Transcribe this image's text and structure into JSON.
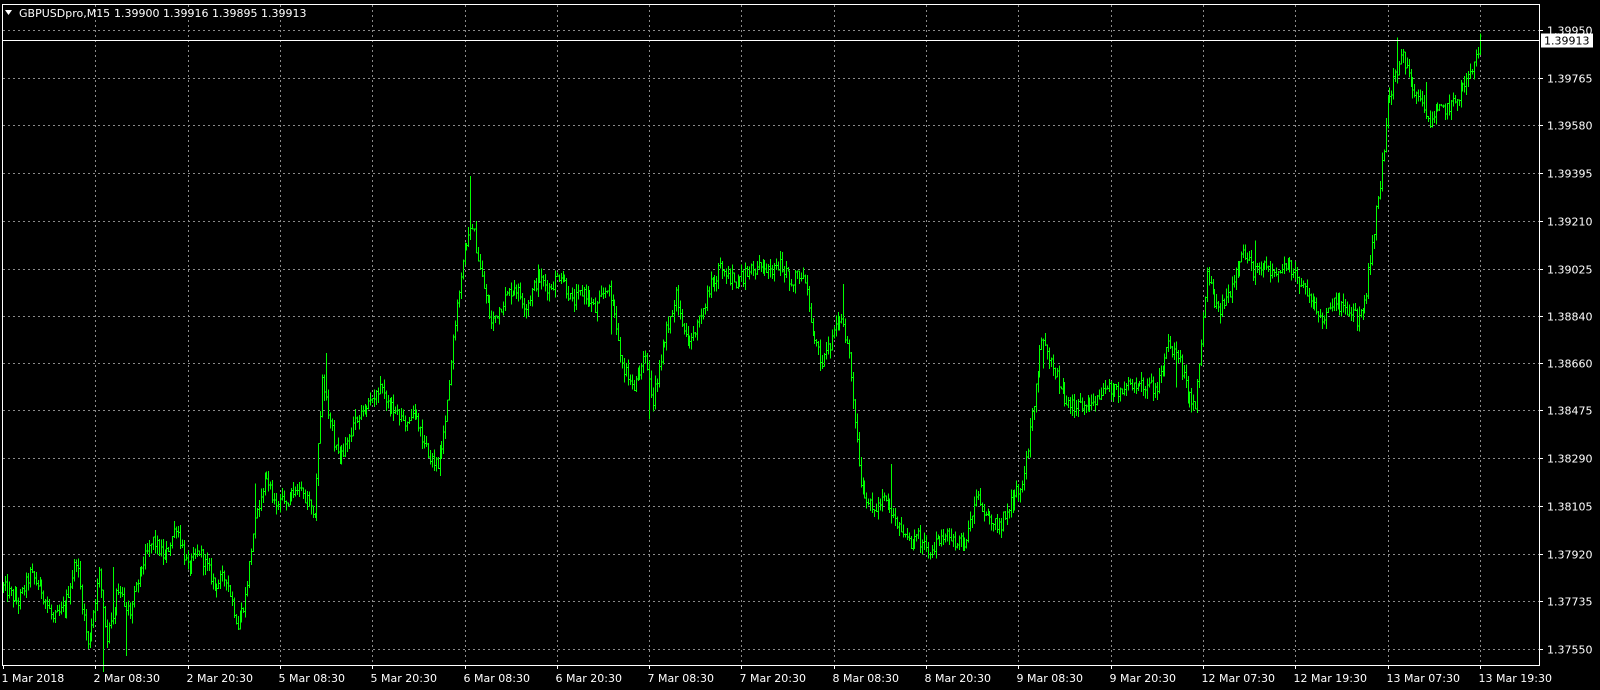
{
  "header": {
    "symbol": "GBPUSDpro,M15",
    "ohlc": "1.39900 1.39916 1.39895 1.39913"
  },
  "colors": {
    "background": "#000000",
    "grid": "#8a8a8a",
    "bars": "#00ff00",
    "frame": "#ffffff",
    "text": "#ffffff",
    "price_line": "#ffffff"
  },
  "chart_data": {
    "type": "line",
    "style": "ohlc-bars",
    "title": "",
    "xlabel": "",
    "ylabel": "",
    "grid": true,
    "ylim": [
      1.3746,
      1.4002
    ],
    "current_price": 1.39913,
    "current_price_label": "1.39913",
    "y_ticks": [
      {
        "value": 1.3995,
        "label": "1.39950"
      },
      {
        "value": 1.39765,
        "label": "1.39765"
      },
      {
        "value": 1.3958,
        "label": "1.39580"
      },
      {
        "value": 1.39395,
        "label": "1.39395"
      },
      {
        "value": 1.3921,
        "label": "1.39210"
      },
      {
        "value": 1.39025,
        "label": "1.39025"
      },
      {
        "value": 1.3884,
        "label": "1.38840"
      },
      {
        "value": 1.3866,
        "label": "1.38660"
      },
      {
        "value": 1.38475,
        "label": "1.38475"
      },
      {
        "value": 1.3829,
        "label": "1.38290"
      },
      {
        "value": 1.38105,
        "label": "1.38105"
      },
      {
        "value": 1.3792,
        "label": "1.37920"
      },
      {
        "value": 1.37735,
        "label": "1.37735"
      },
      {
        "value": 1.3755,
        "label": "1.37550"
      }
    ],
    "x_ticks": [
      "1 Mar 2018",
      "2 Mar 08:30",
      "2 Mar 20:30",
      "5 Mar 08:30",
      "5 Mar 20:30",
      "6 Mar 08:30",
      "6 Mar 20:30",
      "7 Mar 08:30",
      "7 Mar 20:30",
      "8 Mar 08:30",
      "8 Mar 20:30",
      "9 Mar 08:30",
      "9 Mar 20:30",
      "12 Mar 07:30",
      "12 Mar 19:30",
      "13 Mar 07:30",
      "13 Mar 19:30"
    ],
    "series": [
      {
        "bars_per_x_tick": 48,
        "close_path": [
          [
            0,
            1.3779
          ],
          [
            8,
            1.3773
          ],
          [
            14,
            1.3784
          ],
          [
            20,
            1.3778
          ],
          [
            26,
            1.3766
          ],
          [
            32,
            1.3771
          ],
          [
            38,
            1.379
          ],
          [
            44,
            1.3756
          ],
          [
            50,
            1.3784
          ],
          [
            54,
            1.376
          ],
          [
            60,
            1.3778
          ],
          [
            66,
            1.3769
          ],
          [
            72,
            1.3787
          ],
          [
            78,
            1.3797
          ],
          [
            84,
            1.379
          ],
          [
            90,
            1.3803
          ],
          [
            96,
            1.3786
          ],
          [
            102,
            1.3793
          ],
          [
            110,
            1.378
          ],
          [
            116,
            1.3783
          ],
          [
            122,
            1.3764
          ],
          [
            126,
            1.3775
          ],
          [
            130,
            1.38
          ],
          [
            136,
            1.3822
          ],
          [
            142,
            1.3811
          ],
          [
            148,
            1.3812
          ],
          [
            152,
            1.3818
          ],
          [
            158,
            1.3812
          ],
          [
            162,
            1.3808
          ],
          [
            166,
            1.3861
          ],
          [
            172,
            1.3835
          ],
          [
            176,
            1.383
          ],
          [
            180,
            1.3837
          ],
          [
            186,
            1.3848
          ],
          [
            192,
            1.3851
          ],
          [
            196,
            1.3855
          ],
          [
            202,
            1.3848
          ],
          [
            208,
            1.3842
          ],
          [
            214,
            1.3846
          ],
          [
            220,
            1.3832
          ],
          [
            226,
            1.3825
          ],
          [
            230,
            1.3841
          ],
          [
            236,
            1.3891
          ],
          [
            240,
            1.391
          ],
          [
            244,
            1.392
          ],
          [
            248,
            1.3902
          ],
          [
            254,
            1.3881
          ],
          [
            260,
            1.389
          ],
          [
            266,
            1.3896
          ],
          [
            272,
            1.3888
          ],
          [
            278,
            1.3899
          ],
          [
            284,
            1.3895
          ],
          [
            290,
            1.3901
          ],
          [
            296,
            1.3889
          ],
          [
            302,
            1.3894
          ],
          [
            308,
            1.3886
          ],
          [
            314,
            1.3896
          ],
          [
            318,
            1.3884
          ],
          [
            322,
            1.3866
          ],
          [
            328,
            1.3855
          ],
          [
            334,
            1.3869
          ],
          [
            338,
            1.3852
          ],
          [
            344,
            1.3876
          ],
          [
            350,
            1.3893
          ],
          [
            356,
            1.3873
          ],
          [
            362,
            1.3882
          ],
          [
            368,
            1.3896
          ],
          [
            374,
            1.3904
          ],
          [
            380,
            1.3897
          ],
          [
            386,
            1.39
          ],
          [
            392,
            1.3903
          ],
          [
            398,
            1.3901
          ],
          [
            404,
            1.3904
          ],
          [
            410,
            1.3898
          ],
          [
            416,
            1.3902
          ],
          [
            420,
            1.3882
          ],
          [
            426,
            1.3866
          ],
          [
            432,
            1.3876
          ],
          [
            436,
            1.3885
          ],
          [
            440,
            1.3869
          ],
          [
            446,
            1.382
          ],
          [
            452,
            1.3808
          ],
          [
            458,
            1.3813
          ],
          [
            464,
            1.3804
          ],
          [
            470,
            1.3796
          ],
          [
            476,
            1.3798
          ],
          [
            482,
            1.3791
          ],
          [
            488,
            1.38
          ],
          [
            494,
            1.3797
          ],
          [
            500,
            1.3796
          ],
          [
            506,
            1.3815
          ],
          [
            512,
            1.3806
          ],
          [
            518,
            1.3802
          ],
          [
            524,
            1.3813
          ],
          [
            530,
            1.3818
          ],
          [
            536,
            1.385
          ],
          [
            540,
            1.3875
          ],
          [
            546,
            1.3864
          ],
          [
            552,
            1.3853
          ],
          [
            558,
            1.3848
          ],
          [
            564,
            1.3851
          ],
          [
            570,
            1.3853
          ],
          [
            576,
            1.3856
          ],
          [
            582,
            1.3855
          ],
          [
            588,
            1.3859
          ],
          [
            594,
            1.3857
          ],
          [
            600,
            1.3856
          ],
          [
            606,
            1.3873
          ],
          [
            612,
            1.3866
          ],
          [
            616,
            1.3854
          ],
          [
            620,
            1.3848
          ],
          [
            626,
            1.39
          ],
          [
            632,
            1.3885
          ],
          [
            638,
            1.3894
          ],
          [
            644,
            1.391
          ],
          [
            650,
            1.3902
          ],
          [
            656,
            1.3903
          ],
          [
            662,
            1.3902
          ],
          [
            668,
            1.3905
          ],
          [
            674,
            1.3898
          ],
          [
            680,
            1.3888
          ],
          [
            686,
            1.3884
          ],
          [
            692,
            1.389
          ],
          [
            698,
            1.3886
          ],
          [
            704,
            1.3883
          ],
          [
            708,
            1.3888
          ],
          [
            712,
            1.3913
          ],
          [
            716,
            1.3935
          ],
          [
            720,
            1.3965
          ],
          [
            724,
            1.3978
          ],
          [
            728,
            1.3985
          ],
          [
            732,
            1.3974
          ],
          [
            736,
            1.3969
          ],
          [
            742,
            1.396
          ],
          [
            748,
            1.3964
          ],
          [
            754,
            1.3966
          ],
          [
            760,
            1.3974
          ],
          [
            764,
            1.3979
          ],
          [
            768,
            1.3991
          ]
        ],
        "spikes": [
          [
            52,
            0.0023
          ],
          [
            57,
            0.0017
          ],
          [
            64,
            0.0016
          ],
          [
            131,
            0.0013
          ],
          [
            168,
            0.0012
          ],
          [
            243,
            0.0017
          ],
          [
            316,
            0.0011
          ],
          [
            336,
            0.0014
          ],
          [
            437,
            0.0012
          ],
          [
            462,
            0.0016
          ],
          [
            541,
            0.001
          ],
          [
            610,
            0.0012
          ],
          [
            651,
            0.0008
          ],
          [
            725,
            0.0011
          ],
          [
            740,
            0.0009
          ]
        ]
      }
    ]
  }
}
